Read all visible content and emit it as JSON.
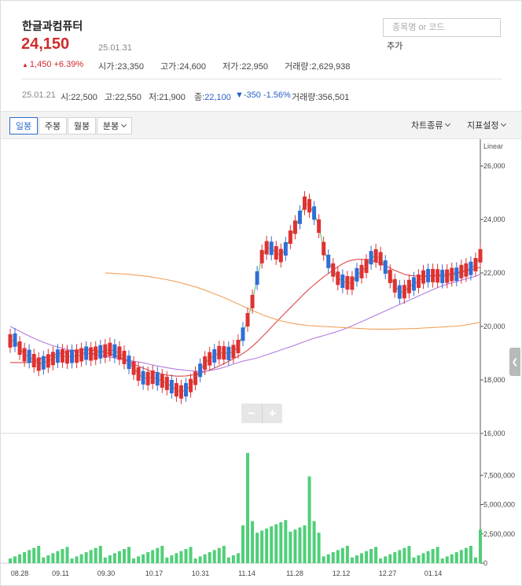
{
  "stock": {
    "name": "한글과컴퓨터",
    "price": "24,150",
    "price_date": "25.01.31",
    "change_arrow": "▲",
    "change": "1,450 +6.39%"
  },
  "stats": {
    "open_label": "시가",
    "open": "23,350",
    "high_label": "고가",
    "high": "24,600",
    "low_label": "저가",
    "low": "22,950",
    "volume_label": "거래량",
    "volume": "2,629,938"
  },
  "search": {
    "placeholder": "종목명 or 코드",
    "add_label": "추가"
  },
  "ohlc": {
    "date": "25.01.21",
    "open_label": "시",
    "open": "22,500",
    "high_label": "고",
    "high": "22,550",
    "low_label": "저",
    "low": "21,900",
    "close_label": "종",
    "close": "22,100",
    "change": "▼-350 -1.56%",
    "volume_label": "거래량",
    "volume": "356,501"
  },
  "toolbar": {
    "tabs": [
      "일봉",
      "주봉",
      "월봉",
      "분봉"
    ],
    "chart_type_label": "차트종류",
    "indicator_label": "지표설정"
  },
  "colors": {
    "up": "#e03131",
    "down": "#2f6fd6",
    "ma5": "#5cc46a",
    "ma20": "#e04848",
    "ma60": "#b57be0",
    "ma120": "#f0a259",
    "volume": "#4fcf78"
  },
  "chart_data": {
    "type": "candlestick",
    "price_scale_label": "Linear",
    "price_ticks": [
      "26,000",
      "24,000",
      "22,000",
      "20,000",
      "18,000",
      "16,000"
    ],
    "price_range": [
      16000,
      27000
    ],
    "volume_ticks": [
      "7,500,000",
      "5,000,000",
      "2,500,000",
      "0"
    ],
    "volume_range": [
      0,
      10000000
    ],
    "x_labels": [
      "08.28",
      "09.11",
      "09.30",
      "10.17",
      "10.31",
      "11.14",
      "11.28",
      "12.12",
      "12.27",
      "01.14"
    ],
    "ma_series": [
      {
        "key": "ma5",
        "values": [
          19460,
          19490,
          19190,
          18940,
          18880,
          18720,
          18590,
          18640,
          18710,
          18800,
          18890,
          18900,
          18860,
          18880,
          18890,
          18940,
          19000,
          18970,
          19000,
          19050,
          19080,
          19140,
          19080,
          19000,
          18840,
          18660,
          18440,
          18220,
          18080,
          18050,
          18100,
          18040,
          17960,
          17870,
          17750,
          17630,
          17550,
          17630,
          17790,
          18060,
          18360,
          18630,
          18790,
          18900,
          19020,
          19010,
          18990,
          19060,
          19250,
          19710,
          20250,
          20930,
          21810,
          22610,
          22940,
          22920,
          22750,
          22650,
          22900,
          23340,
          23710,
          24080,
          24610,
          24510,
          24240,
          23750,
          22910,
          22430,
          22110,
          21800,
          21690,
          21630,
          21620,
          21930,
          22050,
          22250,
          22570,
          22640,
          22530,
          22220,
          21870,
          21520,
          21290,
          21300,
          21490,
          21590,
          21690,
          21850,
          21900,
          21900,
          21890,
          21870,
          21880,
          21940,
          21950,
          22050,
          22110,
          22170,
          22310,
          22640
        ]
      },
      {
        "key": "ma20",
        "values": [
          18650,
          18650,
          18650,
          18650,
          18650,
          18710,
          18770,
          18820,
          18870,
          18920,
          18970,
          19020,
          19060,
          19090,
          19110,
          19120,
          19130,
          19120,
          19100,
          19070,
          19030,
          18980,
          18920,
          18850,
          18770,
          18680,
          18600,
          18510,
          18440,
          18370,
          18310,
          18260,
          18220,
          18180,
          18160,
          18140,
          18140,
          18150,
          18170,
          18210,
          18260,
          18310,
          18370,
          18440,
          18520,
          18610,
          18700,
          18790,
          18880,
          18990,
          19110,
          19260,
          19420,
          19600,
          19780,
          19970,
          20160,
          20340,
          20520,
          20700,
          20880,
          21060,
          21240,
          21410,
          21560,
          21710,
          21850,
          21980,
          22110,
          22230,
          22340,
          22430,
          22480,
          22510,
          22510,
          22510,
          22480,
          22420,
          22350,
          22270,
          22180,
          22090,
          22020,
          21950,
          21910,
          21890,
          21880,
          21880,
          21890,
          21900,
          21910,
          21930,
          21950,
          21980,
          22010,
          22040,
          22080,
          22120,
          22160,
          22220
        ]
      },
      {
        "key": "ma60",
        "values": [
          20000,
          19910,
          19820,
          19730,
          19640,
          19560,
          19480,
          19410,
          19340,
          19280,
          19230,
          19180,
          19140,
          19100,
          19060,
          19030,
          19000,
          18970,
          18940,
          18910,
          18880,
          18850,
          18820,
          18790,
          18760,
          18730,
          18700,
          18670,
          18640,
          18600,
          18560,
          18520,
          18490,
          18460,
          18430,
          18400,
          18380,
          18360,
          18340,
          18330,
          18320,
          18330,
          18350,
          18380,
          18420,
          18470,
          18530,
          18590,
          18650,
          18700,
          18740,
          18780,
          18820,
          18880,
          18940,
          19000,
          19060,
          19120,
          19180,
          19240,
          19300,
          19370,
          19430,
          19500,
          19560,
          19610,
          19660,
          19710,
          19760,
          19820,
          19880,
          19950,
          20020,
          20100,
          20180,
          20260,
          20340,
          20420,
          20500,
          20580,
          20660,
          20740,
          20820,
          20900,
          20980,
          21060,
          21140,
          21220,
          21300,
          21380,
          21450,
          21520,
          21580,
          21630,
          21680,
          21730,
          21780,
          21830,
          21880,
          21960
        ]
      },
      {
        "key": "ma120",
        "values": [
          null,
          null,
          null,
          null,
          null,
          null,
          null,
          null,
          null,
          null,
          null,
          null,
          null,
          null,
          null,
          null,
          null,
          null,
          null,
          null,
          22000,
          21990,
          21980,
          21970,
          21960,
          21950,
          21930,
          21910,
          21890,
          21870,
          21840,
          21810,
          21780,
          21750,
          21710,
          21670,
          21630,
          21580,
          21530,
          21480,
          21420,
          21360,
          21290,
          21220,
          21150,
          21080,
          21000,
          20920,
          20840,
          20760,
          20680,
          20600,
          20520,
          20450,
          20380,
          20320,
          20260,
          20210,
          20170,
          20130,
          20100,
          20070,
          20050,
          20030,
          20020,
          20010,
          20000,
          19990,
          19980,
          19970,
          19960,
          19950,
          19940,
          19930,
          19920,
          19910,
          19900,
          19900,
          19900,
          19900,
          19900,
          19900,
          19910,
          19910,
          19920,
          19920,
          19930,
          19940,
          19950,
          19960,
          19970,
          19980,
          19990,
          20000,
          20010,
          20030,
          20060,
          20090,
          20120,
          20160
        ]
      }
    ]
  }
}
